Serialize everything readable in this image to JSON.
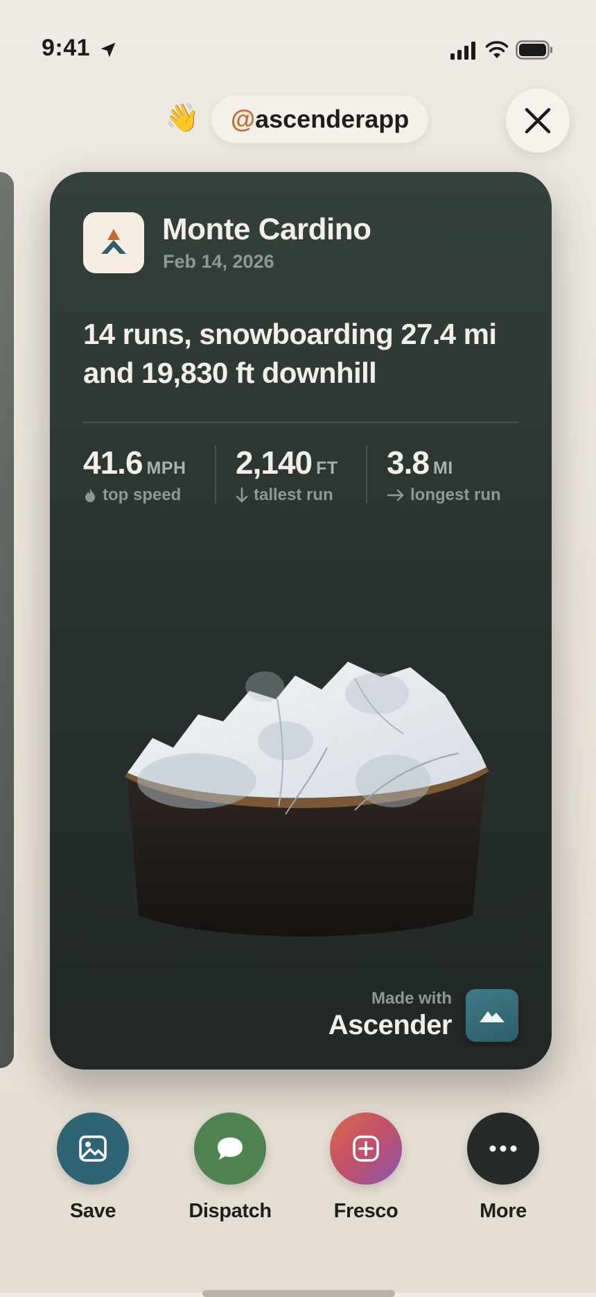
{
  "status_bar": {
    "time": "9:41",
    "icons": [
      "location-arrow-icon",
      "cellular-signal-icon",
      "wifi-icon",
      "battery-icon"
    ]
  },
  "header": {
    "wave_emoji": "👋",
    "handle_at": "@",
    "handle_name": "ascenderapp",
    "close_icon": "close-icon"
  },
  "card": {
    "resort_name": "Monte Cardino",
    "date": "Feb 14, 2026",
    "summary_line1": "14 runs, snowboarding 27.4 mi",
    "summary_line2": "and 19,830 ft downhill",
    "stats": [
      {
        "value": "41.6",
        "unit": "MPH",
        "label": "top speed",
        "icon": "flame-icon"
      },
      {
        "value": "2,140",
        "unit": "FT",
        "label": "tallest run",
        "icon": "arrow-down-icon"
      },
      {
        "value": "3.8",
        "unit": "MI",
        "label": "longest run",
        "icon": "arrow-right-icon"
      }
    ],
    "made_with_label": "Made with",
    "brand_name": "Ascender",
    "brand_icon": "mountain-icon"
  },
  "actions": [
    {
      "label": "Save",
      "icon": "image-icon",
      "color": "#2f6474"
    },
    {
      "label": "Dispatch",
      "icon": "chat-bubble-icon",
      "color": "#4f8452"
    },
    {
      "label": "Fresco",
      "icon": "plus-square-icon",
      "color": "#c0506a"
    },
    {
      "label": "More",
      "icon": "more-dots-icon",
      "color": "#262a29"
    }
  ],
  "colors": {
    "accent_orange": "#c8692e",
    "card_bg": "#2b3431",
    "page_bg": "#ebe6de"
  }
}
